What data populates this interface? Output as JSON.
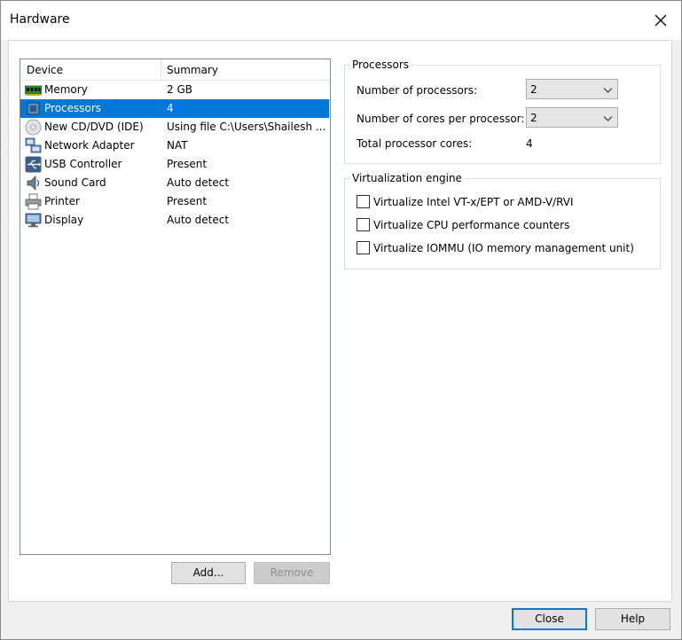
{
  "window": {
    "title": "Hardware"
  },
  "device_list": {
    "columns": {
      "device": "Device",
      "summary": "Summary"
    },
    "rows": [
      {
        "icon": "memory-icon",
        "name": "Memory",
        "summary": "2 GB",
        "selected": false
      },
      {
        "icon": "processor-icon",
        "name": "Processors",
        "summary": "4",
        "selected": true
      },
      {
        "icon": "cd-dvd-icon",
        "name": "New CD/DVD (IDE)",
        "summary": "Using file C:\\Users\\Shailesh ...",
        "selected": false
      },
      {
        "icon": "network-adapter-icon",
        "name": "Network Adapter",
        "summary": "NAT",
        "selected": false
      },
      {
        "icon": "usb-icon",
        "name": "USB Controller",
        "summary": "Present",
        "selected": false
      },
      {
        "icon": "sound-card-icon",
        "name": "Sound Card",
        "summary": "Auto detect",
        "selected": false
      },
      {
        "icon": "printer-icon",
        "name": "Printer",
        "summary": "Present",
        "selected": false
      },
      {
        "icon": "display-icon",
        "name": "Display",
        "summary": "Auto detect",
        "selected": false
      }
    ]
  },
  "list_buttons": {
    "add": "Add...",
    "remove": "Remove"
  },
  "processors": {
    "legend": "Processors",
    "num_processors_label": "Number of processors:",
    "num_processors_value": "2",
    "cores_label": "Number of cores per processor:",
    "cores_value": "2",
    "total_label": "Total processor cores:",
    "total_value": "4"
  },
  "virtualization": {
    "legend": "Virtualization engine",
    "options": [
      {
        "label": "Virtualize Intel VT-x/EPT or AMD-V/RVI",
        "checked": false
      },
      {
        "label": "Virtualize CPU performance counters",
        "checked": false
      },
      {
        "label": "Virtualize IOMMU (IO memory management unit)",
        "checked": false
      }
    ]
  },
  "footer": {
    "close": "Close",
    "help": "Help"
  },
  "colors": {
    "selection": "#0078d7",
    "window_bg": "#f0f0f0"
  }
}
